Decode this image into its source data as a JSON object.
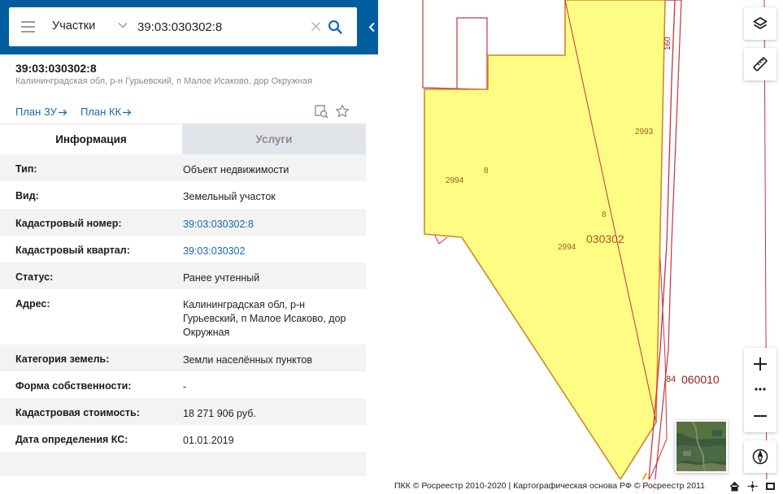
{
  "search": {
    "type_label": "Участки",
    "query": "39:03:030302:8"
  },
  "object": {
    "title": "39:03:030302:8",
    "address": "Калининградская обл, р-н Гурьевский, п Малое Исаково, дор Окружная"
  },
  "plan_links": {
    "zu": "План ЗУ",
    "kk": "План КК"
  },
  "tabs": {
    "info": "Информация",
    "services": "Услуги"
  },
  "info": {
    "rows": [
      {
        "label": "Тип:",
        "value": "Объект недвижимости"
      },
      {
        "label": "Вид:",
        "value": "Земельный участок"
      },
      {
        "label": "Кадастровый номер:",
        "value": "39:03:030302:8"
      },
      {
        "label": "Кадастровый квартал:",
        "value": "39:03:030302"
      },
      {
        "label": "Статус:",
        "value": "Ранее учтенный"
      },
      {
        "label": "Адрес:",
        "value": "Калининградская обл, р-н Гурьевский, п Малое Исаково, дор Окружная"
      },
      {
        "label": "Категория земель:",
        "value": "Земли населённых пунктов"
      },
      {
        "label": "Форма собственности:",
        "value": "-"
      },
      {
        "label": "Кадастровая стоимость:",
        "value": "18 271 906 руб."
      },
      {
        "label": "Дата определения КС:",
        "value": "01.01.2019"
      }
    ]
  },
  "map": {
    "labels": {
      "l2993": "2993",
      "l2994a": "2994",
      "l8a": "8",
      "l8b": "8",
      "l2994b": "2994",
      "l030302": "030302",
      "l160": "160",
      "l84": "84",
      "l060010": "060010"
    },
    "attribution": "ПКК © Росреестр 2010-2020 | Картографическая основа РФ © Росреестр 2011"
  },
  "colors": {
    "header_blue": "#005e9e",
    "link_blue": "#1668b3",
    "parcel_fill": "#fdfd7a",
    "parcel_border": "#c8323c",
    "label_orange": "#b0561d"
  },
  "icons": {
    "menu": "menu-icon",
    "chevron": "chevron-down-icon",
    "clear": "close-icon",
    "search": "search-icon",
    "collapse": "chevron-left-icon",
    "find_on_map": "find-on-map-icon",
    "favorite": "star-icon",
    "layers": "layers-icon",
    "ruler": "ruler-icon",
    "zoom_in": "plus-icon",
    "more": "more-icon",
    "zoom_out": "minus-icon",
    "compass": "compass-icon",
    "home": "home-icon",
    "locate": "locate-icon",
    "fullscreen": "fullscreen-icon"
  }
}
